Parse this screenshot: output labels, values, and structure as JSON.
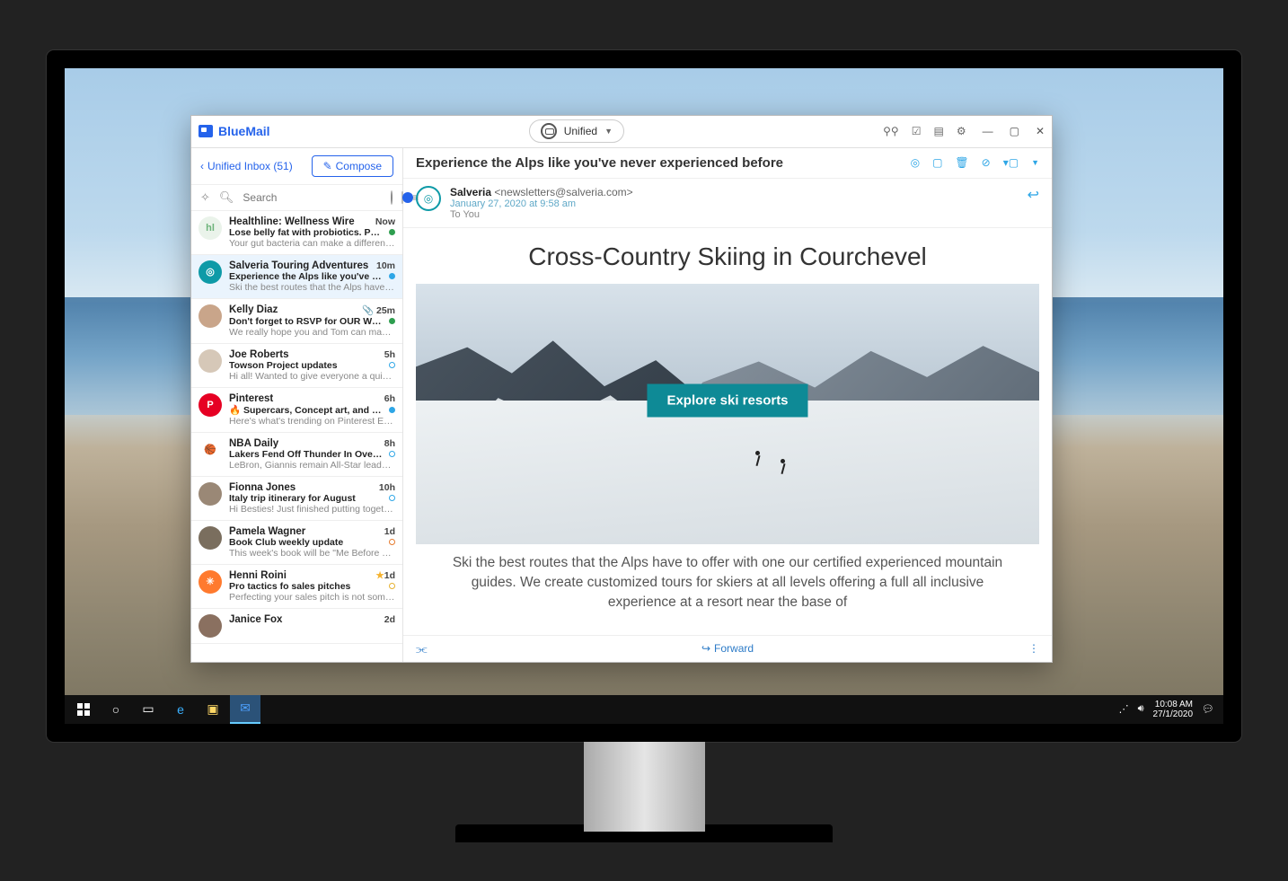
{
  "brand": "BlueMail",
  "account_selector": "Unified",
  "window_controls": {
    "min": "—",
    "max": "▢",
    "close": "✕"
  },
  "sidebar": {
    "back_label": "Unified Inbox (51)",
    "compose_label": "Compose",
    "search_placeholder": "Search"
  },
  "emails": [
    {
      "sender": "Healthline: Wellness Wire",
      "time": "Now",
      "subject": "Lose belly fat with probiotics. Power walking...",
      "preview": "Your gut bacteria can make a difference in...",
      "dot": "g",
      "av": {
        "bg": "#eaf3ea",
        "txt": "hl",
        "fg": "#6db37a"
      }
    },
    {
      "sender": "Salveria Touring Adventures",
      "time": "10m",
      "subject": "Experience the Alps like you've never experie...",
      "preview": "Ski the best routes that the Alps have to offer...",
      "dot": "b",
      "av": {
        "bg": "#0e9aa7",
        "txt": "◎",
        "fg": "#fff"
      },
      "selected": true
    },
    {
      "sender": "Kelly Diaz",
      "time": "25m",
      "subject": "Don't forget to RSVP for OUR Wedding!!",
      "preview": "We really hope you and Tom can make it!...",
      "dot": "g",
      "av": {
        "bg": "#c9a58a",
        "txt": "",
        "fg": "#fff"
      },
      "badge": "📎"
    },
    {
      "sender": "Joe Roberts",
      "time": "5h",
      "subject": "Towson Project updates",
      "preview": "Hi all! Wanted to give everyone a quick updat...",
      "dot": "ob",
      "av": {
        "bg": "#d6c8b8",
        "txt": "",
        "fg": "#fff"
      }
    },
    {
      "sender": "Pinterest",
      "time": "6h",
      "subject": "🔥 Supercars, Concept art, and more Pins...",
      "preview": "Here's what's trending on Pinterest EQ silver...",
      "dot": "b",
      "av": {
        "bg": "#e60023",
        "txt": "P",
        "fg": "#fff"
      }
    },
    {
      "sender": "NBA Daily",
      "time": "8h",
      "subject": "Lakers Fend Off Thunder In Overtime; Take...",
      "preview": "LeBron, Giannis remain All-Star leaders >>",
      "dot": "ob",
      "av": {
        "bg": "#fff",
        "txt": "🏀",
        "fg": "#1d428a"
      }
    },
    {
      "sender": "Fionna Jones",
      "time": "10h",
      "subject": "Italy trip itinerary for August",
      "preview": "Hi Besties! Just finished putting together an...",
      "dot": "ob",
      "av": {
        "bg": "#9a8876",
        "txt": "",
        "fg": "#fff"
      }
    },
    {
      "sender": "Pamela Wagner",
      "time": "1d",
      "subject": "Book Club weekly update",
      "preview": "This week's book will be \"Me Before You\" by...",
      "dot": "oo",
      "av": {
        "bg": "#7a6e5e",
        "txt": "",
        "fg": "#fff"
      }
    },
    {
      "sender": "Henni Roini",
      "time": "1d",
      "subject": "Pro tactics fo sales pitches",
      "preview": "Perfecting your sales pitch is not something...",
      "dot": "oy",
      "av": {
        "bg": "#ff7a2e",
        "txt": "✳",
        "fg": "#fff"
      },
      "star": true
    },
    {
      "sender": "Janice Fox",
      "time": "2d",
      "subject": "",
      "preview": "",
      "dot": "",
      "av": {
        "bg": "#8a7060",
        "txt": "",
        "fg": "#fff"
      }
    }
  ],
  "message": {
    "subject": "Experience the Alps like you've never experienced before",
    "from_name": "Salveria",
    "from_addr": "<newsletters@salveria.com>",
    "date": "January 27, 2020 at 9:58 am",
    "to": "To You",
    "title": "Cross-Country Skiing in Courchevel",
    "cta": "Explore ski resorts",
    "body": "Ski the best routes that the Alps have to offer with one our certified experienced mountain guides. We create customized tours for skiers at all levels offering a full all inclusive experience at a resort near the base of",
    "forward": "Forward"
  },
  "taskbar": {
    "time": "10:08 AM",
    "date": "27/1/2020"
  }
}
